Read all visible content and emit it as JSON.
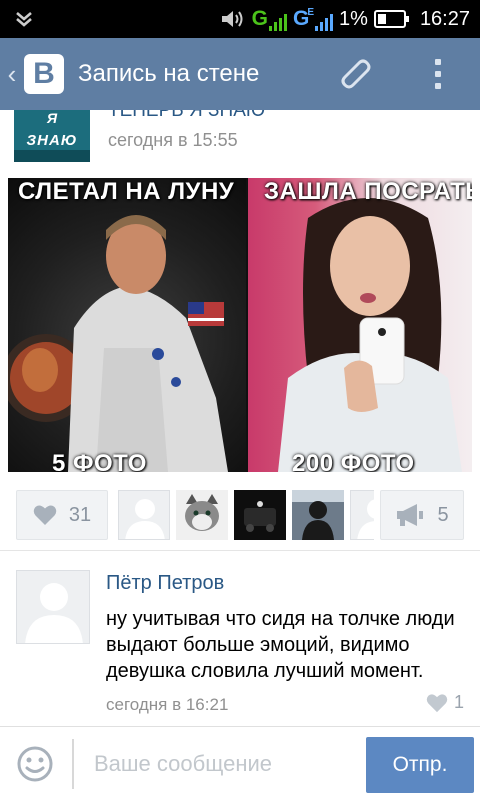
{
  "status_bar": {
    "time": "16:27",
    "battery_percent": "1%",
    "network1": "G",
    "network2": "G",
    "network2_sup": "E",
    "icons": [
      "download-icon",
      "volume-icon",
      "signal-icon",
      "battery-icon"
    ]
  },
  "app_bar": {
    "logo": "В",
    "title": "Запись на стене",
    "icons": [
      "back-chevron-icon",
      "paperclip-icon",
      "overflow-menu-icon"
    ],
    "accent": "#5f7ea3"
  },
  "post": {
    "author": "ТЕПЕРЬ Я ЗНАЮ",
    "avatar_text_top": "Я",
    "avatar_text_main": "ЗНАЮ",
    "time": "сегодня в 15:55",
    "image": {
      "left_caption_top": "СЛЕТАЛ НА ЛУНУ",
      "left_caption_bottom": "5 ФОТО",
      "right_caption_top": "ЗАШЛА ПОСРАТЬ",
      "right_caption_bottom": "200 ФОТО"
    },
    "likes": "31",
    "shares": "5",
    "likers": [
      "placeholder",
      "cat",
      "car",
      "person",
      "placeholder"
    ]
  },
  "comment": {
    "author": "Пётр Петров",
    "text": "ну учитывая что сидя на толчке люди выдают больше эмоций, видимо девушка словила лучший момент.",
    "time": "сегодня в 16:21",
    "likes": "1"
  },
  "composer": {
    "placeholder": "Ваше сообщение",
    "send_label": "Отпр."
  }
}
